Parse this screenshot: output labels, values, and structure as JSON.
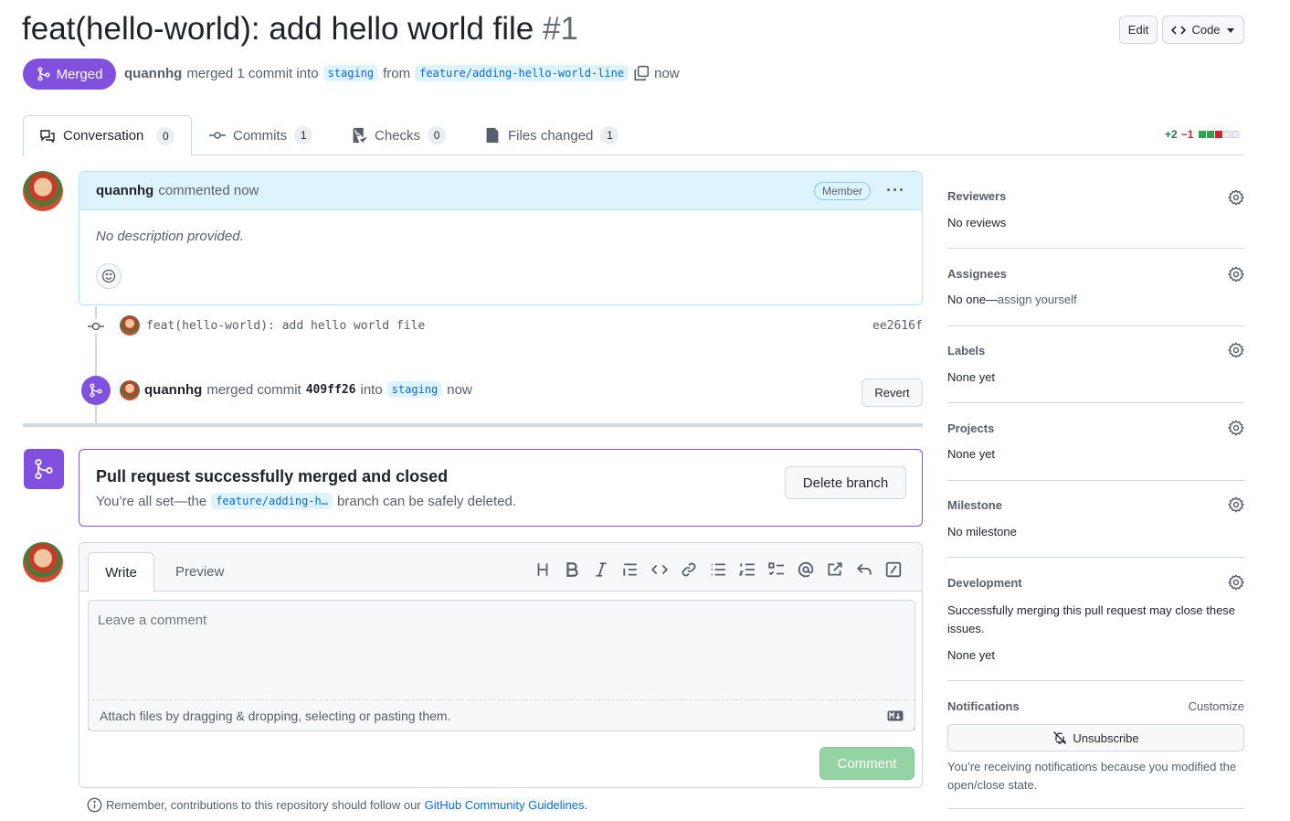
{
  "header": {
    "title": "feat(hello-world): add hello world file",
    "number": "#1",
    "edit_label": "Edit",
    "code_label": "Code",
    "state_label": "Merged",
    "author": "quannhg",
    "merge_text": "merged 1 commit into",
    "base_branch": "staging",
    "from_text": "from",
    "head_branch": "feature/adding-hello-world-line",
    "time": "now"
  },
  "tabs": [
    {
      "label": "Conversation",
      "count": "0"
    },
    {
      "label": "Commits",
      "count": "1"
    },
    {
      "label": "Checks",
      "count": "0"
    },
    {
      "label": "Files changed",
      "count": "1"
    }
  ],
  "diffstat": {
    "added": "+2",
    "removed": "−1"
  },
  "comment": {
    "author": "quannhg",
    "action": "commented now",
    "role": "Member",
    "body": "No description provided."
  },
  "commit": {
    "message": "feat(hello-world): add hello world file",
    "sha": "ee2616f"
  },
  "merge_event": {
    "author": "quannhg",
    "text1": "merged commit",
    "sha": "409ff26",
    "text2": "into",
    "branch": "staging",
    "time": "now",
    "revert_label": "Revert"
  },
  "merged_box": {
    "title": "Pull request successfully merged and closed",
    "text1": "You’re all set—the",
    "branch": "feature/adding-h…",
    "text2": "branch can be safely deleted.",
    "delete_label": "Delete branch"
  },
  "editor": {
    "write_tab": "Write",
    "preview_tab": "Preview",
    "placeholder": "Leave a comment",
    "attach_text": "Attach files by dragging & dropping, selecting or pasting them.",
    "submit_label": "Comment",
    "footer_text": "Remember, contributions to this repository should follow our",
    "footer_link": "GitHub Community Guidelines",
    "footer_end": "."
  },
  "sidebar": {
    "reviewers": {
      "title": "Reviewers",
      "value": "No reviews"
    },
    "assignees": {
      "title": "Assignees",
      "value": "No one—",
      "link": "assign yourself"
    },
    "labels": {
      "title": "Labels",
      "value": "None yet"
    },
    "projects": {
      "title": "Projects",
      "value": "None yet"
    },
    "milestone": {
      "title": "Milestone",
      "value": "No milestone"
    },
    "development": {
      "title": "Development",
      "text": "Successfully merging this pull request may close these issues.",
      "value": "None yet"
    },
    "notifications": {
      "title": "Notifications",
      "customize": "Customize",
      "unsubscribe": "Unsubscribe",
      "reason": "You’re receiving notifications because you modified the open/close state."
    }
  },
  "colors": {
    "merged": "#8250df",
    "link": "#0969da",
    "green": "#1a7f37",
    "red": "#cf222e",
    "comment_bg": "#ddf4ff"
  }
}
